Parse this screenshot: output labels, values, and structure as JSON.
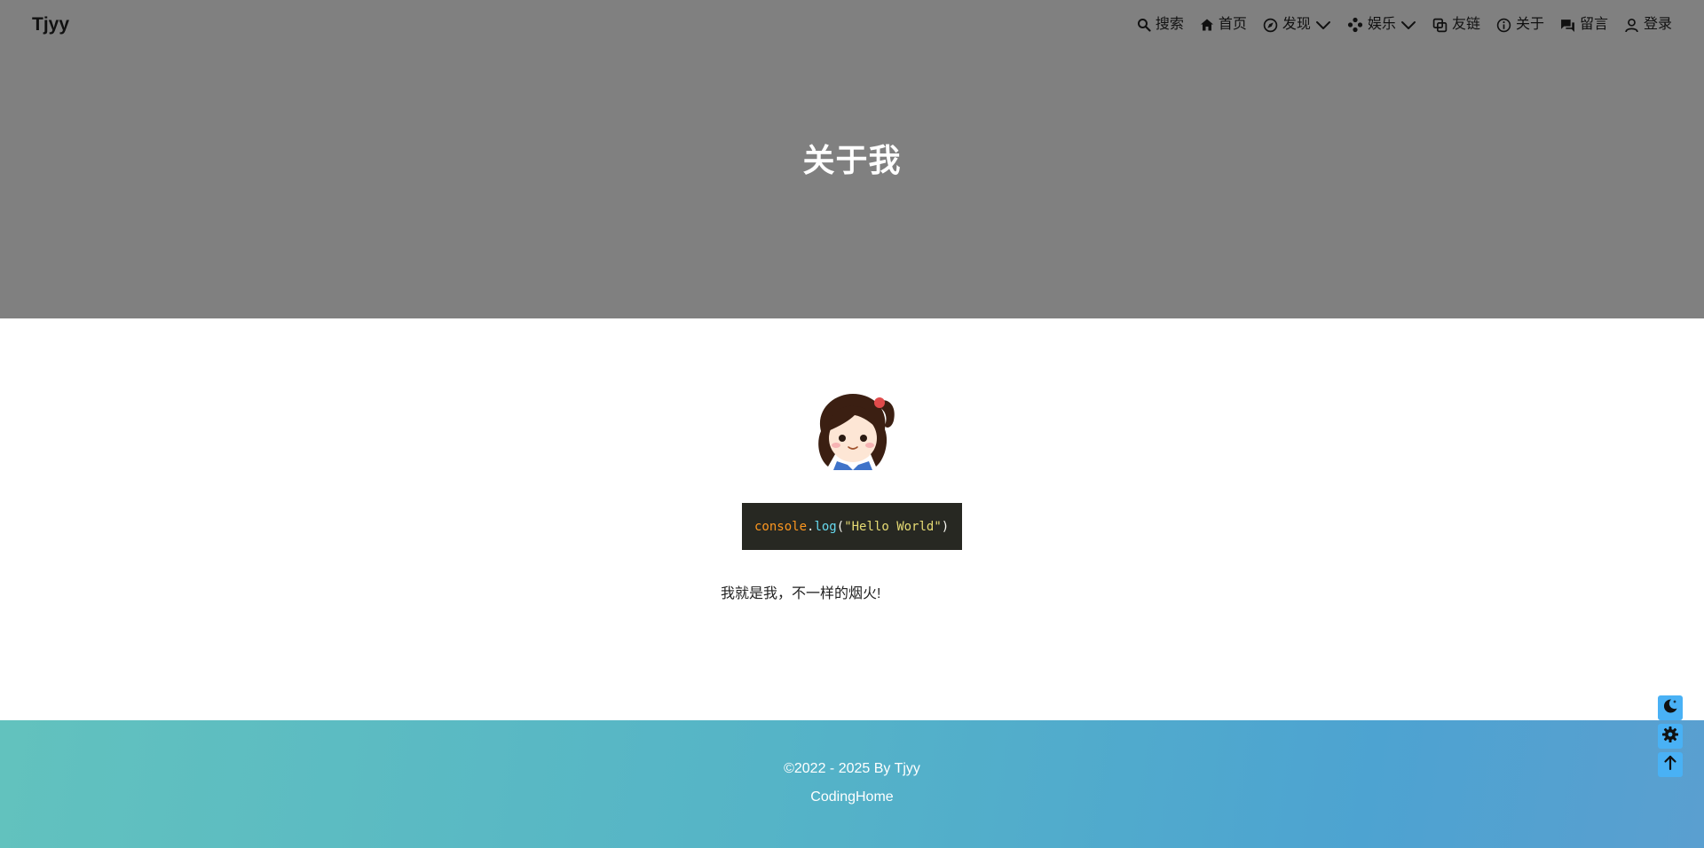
{
  "brand": "Tjyy",
  "nav": {
    "search": "搜索",
    "home": "首页",
    "discover": "发现",
    "entertainment": "娱乐",
    "links": "友链",
    "about": "关于",
    "messages": "留言",
    "login": "登录"
  },
  "hero": {
    "title": "关于我"
  },
  "code": {
    "obj": "console",
    "dot": ".",
    "fn": "log",
    "open": "(",
    "str": "\"Hello World\"",
    "close": ")"
  },
  "intro": "我就是我，不一样的烟火!",
  "footer": {
    "copyright": "©2022 - 2025 By Tjyy",
    "site": "CodingHome"
  },
  "float_buttons": [
    "moon-icon",
    "gear-icon",
    "arrow-up-icon"
  ],
  "colors": {
    "hero_bg": "#808080",
    "accent": "#49b1f5",
    "footer_start": "#62c2be",
    "footer_end": "#5a9fd0"
  }
}
